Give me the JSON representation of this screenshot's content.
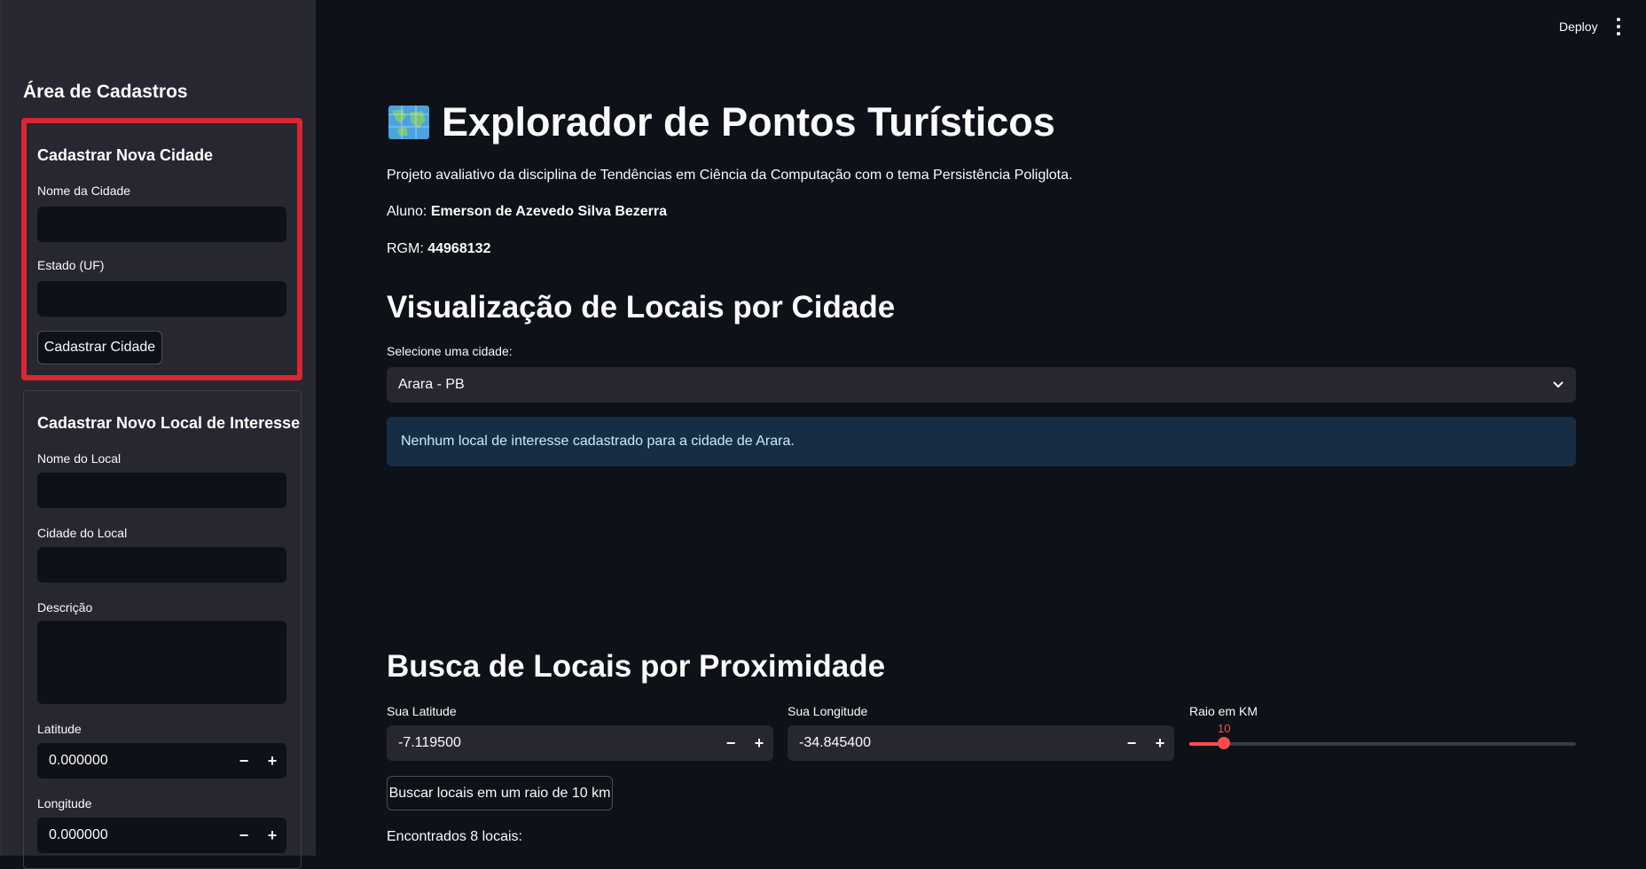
{
  "header": {
    "deploy_label": "Deploy",
    "menu_icon": "kebab-menu-icon"
  },
  "sidebar": {
    "title": "Área de Cadastros",
    "city_form": {
      "heading": "Cadastrar Nova Cidade",
      "name_label": "Nome da Cidade",
      "name_value": "",
      "state_label": "Estado (UF)",
      "state_value": "",
      "submit_label": "Cadastrar Cidade"
    },
    "local_form": {
      "heading": "Cadastrar Novo Local de Interesse",
      "name_label": "Nome do Local",
      "city_label": "Cidade do Local",
      "desc_label": "Descrição",
      "lat_label": "Latitude",
      "lat_value": "0.000000",
      "lon_label": "Longitude",
      "lon_value": "0.000000"
    }
  },
  "main": {
    "title_icon": "world-map-icon",
    "title": "Explorador de Pontos Turísticos",
    "description": "Projeto avaliativo da disciplina de Tendências em Ciência da Computação com o tema Persistência Poliglota.",
    "student_label": "Aluno:",
    "student_name": "Emerson de Azevedo Silva Bezerra",
    "rgm_label": "RGM:",
    "rgm_value": "44968132",
    "city_section": {
      "heading": "Visualização de Locais por Cidade",
      "select_label": "Selecione uma cidade:",
      "selected_city": "Arara - PB",
      "info_message": "Nenhum local de interesse cadastrado para a cidade de Arara."
    },
    "proximity_section": {
      "heading": "Busca de Locais por Proximidade",
      "lat_label": "Sua Latitude",
      "lat_value": "-7.119500",
      "lon_label": "Sua Longitude",
      "lon_value": "-34.845400",
      "radius_label": "Raio em KM",
      "radius_value": "10",
      "radius_fraction": 0.09,
      "search_button": "Buscar locais em um raio de 10 km",
      "result_text": "Encontrados 8 locais:"
    }
  },
  "colors": {
    "accent": "#ff4b4b",
    "highlight_border": "#d9262f",
    "info_bg": "#172d43"
  }
}
